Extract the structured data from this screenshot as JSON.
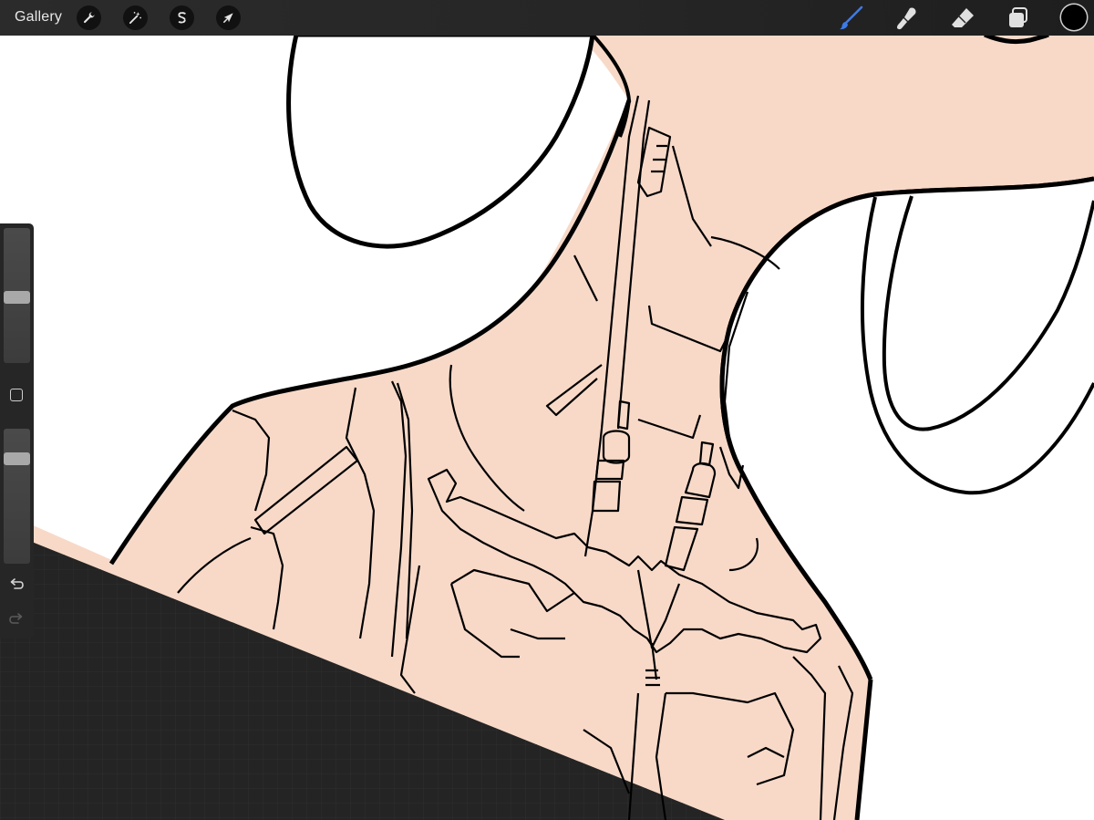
{
  "topbar": {
    "gallery_label": "Gallery",
    "left_tools": [
      {
        "name": "actions",
        "icon": "wrench-icon"
      },
      {
        "name": "adjustments",
        "icon": "magic-wand-icon"
      },
      {
        "name": "selection",
        "icon": "selection-s-icon"
      },
      {
        "name": "transform",
        "icon": "arrow-cursor-icon"
      }
    ],
    "right_tools": [
      {
        "name": "brush",
        "icon": "brush-icon",
        "active": true
      },
      {
        "name": "smudge",
        "icon": "smudge-icon",
        "active": false
      },
      {
        "name": "eraser",
        "icon": "eraser-icon",
        "active": false
      },
      {
        "name": "layers",
        "icon": "layers-icon",
        "active": false
      }
    ],
    "current_color": "#000000"
  },
  "sidebar": {
    "brush_size_level": 0.48,
    "opacity_level": 0.78,
    "modify_button_icon": "square-icon",
    "undo_icon": "undo-icon",
    "redo_icon": "redo-icon"
  },
  "colors": {
    "accent": "#3d7be8",
    "skin_fill": "#f8d9c8",
    "toolbar_bg": "#262626",
    "canvas_bg": "#ffffff",
    "dark_panel": "#242424",
    "line_art": "#000000"
  }
}
